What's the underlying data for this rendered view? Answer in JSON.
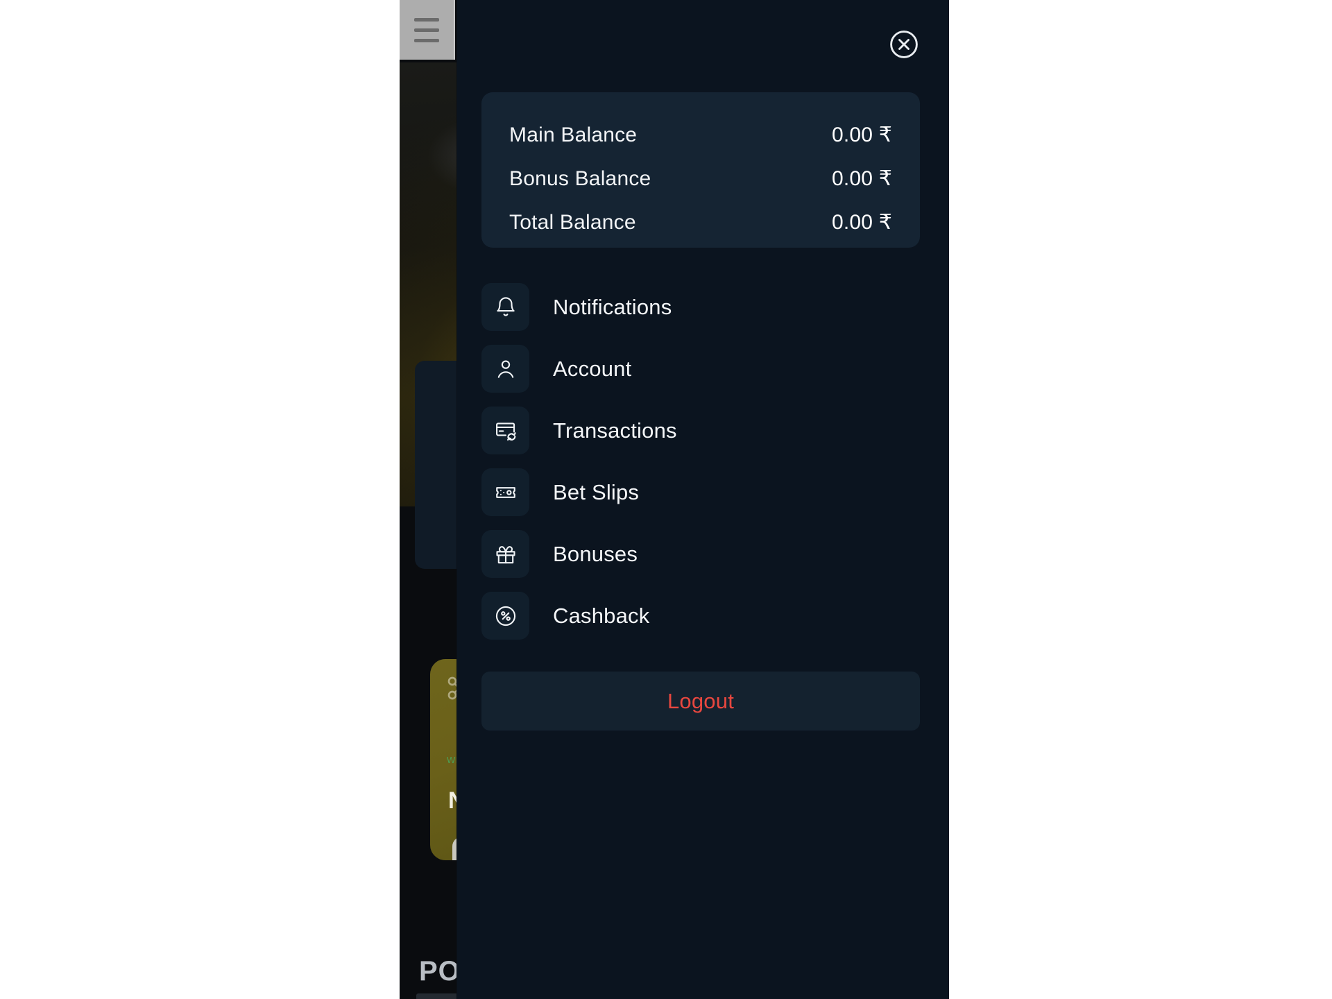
{
  "window": {
    "background_color": "#ffffff",
    "app_background_color": "#0a0c0f"
  },
  "background_app": {
    "hamburger_icon": "hamburger-menu-icon",
    "promo_card": {
      "badge_text": "WELCOME",
      "title_partial": "N",
      "icon": "scissors-icon",
      "button_label": ""
    },
    "footer_text_partial": "POI"
  },
  "drawer": {
    "background_color": "#0b141f",
    "close_icon": "close-circle-icon",
    "balance_card": {
      "background_color": "#152433",
      "rows": [
        {
          "label": "Main Balance",
          "value": "0.00 ₹"
        },
        {
          "label": "Bonus Balance",
          "value": "0.00 ₹"
        },
        {
          "label": "Total Balance",
          "value": "0.00 ₹"
        }
      ]
    },
    "menu": {
      "items": [
        {
          "label": "Notifications",
          "icon": "bell-icon"
        },
        {
          "label": "Account",
          "icon": "user-icon"
        },
        {
          "label": "Transactions",
          "icon": "card-refresh-icon"
        },
        {
          "label": "Bet Slips",
          "icon": "ticket-icon"
        },
        {
          "label": "Bonuses",
          "icon": "gift-icon"
        },
        {
          "label": "Cashback",
          "icon": "percent-circle-icon"
        }
      ]
    },
    "logout": {
      "label": "Logout",
      "text_color": "#e8473f",
      "background_color": "#14222f"
    }
  }
}
